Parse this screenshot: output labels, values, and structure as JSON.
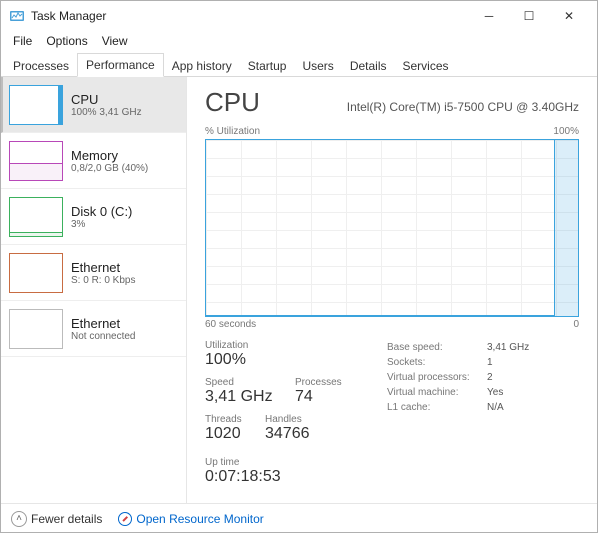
{
  "window": {
    "title": "Task Manager"
  },
  "menu": {
    "file": "File",
    "options": "Options",
    "view": "View"
  },
  "tabs": {
    "processes": "Processes",
    "performance": "Performance",
    "app_history": "App history",
    "startup": "Startup",
    "users": "Users",
    "details": "Details",
    "services": "Services"
  },
  "sidebar": {
    "cpu": {
      "label": "CPU",
      "sub": "100% 3,41 GHz"
    },
    "memory": {
      "label": "Memory",
      "sub": "0,8/2,0 GB (40%)"
    },
    "disk": {
      "label": "Disk 0 (C:)",
      "sub": "3%"
    },
    "eth1": {
      "label": "Ethernet",
      "sub": "S: 0 R: 0 Kbps"
    },
    "eth2": {
      "label": "Ethernet",
      "sub": "Not connected"
    }
  },
  "main": {
    "title": "CPU",
    "cpu_name": "Intel(R) Core(TM) i5-7500 CPU @ 3.40GHz",
    "util_label": "% Utilization",
    "util_max": "100%",
    "time_left": "60 seconds",
    "time_right": "0",
    "stats": {
      "utilization": {
        "label": "Utilization",
        "value": "100%"
      },
      "speed": {
        "label": "Speed",
        "value": "3,41 GHz"
      },
      "processes": {
        "label": "Processes",
        "value": "74"
      },
      "threads": {
        "label": "Threads",
        "value": "1020"
      },
      "handles": {
        "label": "Handles",
        "value": "34766"
      }
    },
    "side_stats": {
      "base_speed": {
        "label": "Base speed:",
        "value": "3,41 GHz"
      },
      "sockets": {
        "label": "Sockets:",
        "value": "1"
      },
      "vproc": {
        "label": "Virtual processors:",
        "value": "2"
      },
      "vm": {
        "label": "Virtual machine:",
        "value": "Yes"
      },
      "l1": {
        "label": "L1 cache:",
        "value": "N/A"
      }
    },
    "uptime": {
      "label": "Up time",
      "value": "0:07:18:53"
    }
  },
  "footer": {
    "fewer": "Fewer details",
    "orm": "Open Resource Monitor"
  },
  "chart_data": {
    "type": "line",
    "title": "CPU % Utilization",
    "xlabel": "seconds",
    "ylabel": "% Utilization",
    "xlim": [
      0,
      60
    ],
    "ylim": [
      0,
      100
    ],
    "x": [
      60,
      55,
      50,
      45,
      40,
      35,
      30,
      25,
      20,
      15,
      10,
      5,
      4,
      3,
      2,
      1,
      0
    ],
    "y": [
      1,
      1,
      1,
      1,
      1,
      1,
      1,
      1,
      1,
      1,
      1,
      2,
      100,
      100,
      100,
      100,
      100
    ]
  }
}
